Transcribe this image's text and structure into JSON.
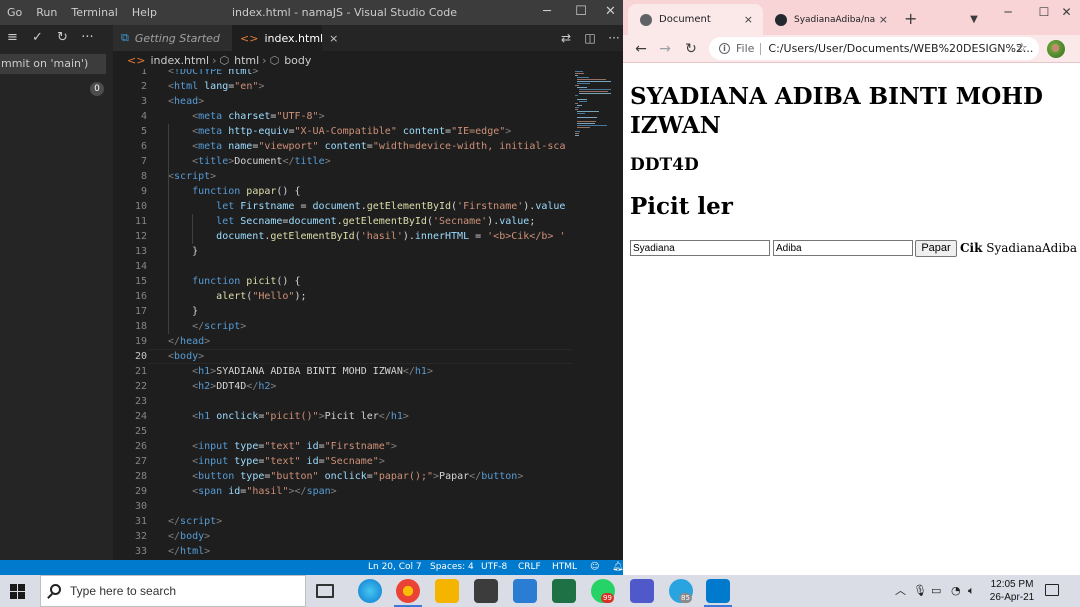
{
  "vscode": {
    "menu": [
      "Go",
      "Run",
      "Terminal",
      "Help"
    ],
    "window_title": "index.html - namaJS - Visual Studio Code",
    "commit_placeholder": "mmit on 'main')",
    "changes_badge": "0",
    "tabs": [
      {
        "label": "Getting Started"
      },
      {
        "label": "index.html",
        "close": "×"
      }
    ],
    "breadcrumb": [
      "index.html",
      "html",
      "body"
    ],
    "code_lines": [
      {
        "n": "1",
        "tokens": [
          [
            "t-br",
            "<"
          ],
          [
            "t-dt",
            "!DOCTYPE"
          ],
          [
            "t-txt",
            " "
          ],
          [
            "t-attr",
            "html"
          ],
          [
            "t-br",
            ">"
          ]
        ]
      },
      {
        "n": "2",
        "tokens": [
          [
            "t-br",
            "<"
          ],
          [
            "t-tag",
            "html"
          ],
          [
            "t-txt",
            " "
          ],
          [
            "t-attr",
            "lang"
          ],
          [
            "t-txt",
            "="
          ],
          [
            "t-str",
            "\"en\""
          ],
          [
            "t-br",
            ">"
          ]
        ]
      },
      {
        "n": "3",
        "tokens": [
          [
            "t-br",
            "<"
          ],
          [
            "t-tag",
            "head"
          ],
          [
            "t-br",
            ">"
          ]
        ]
      },
      {
        "n": "4",
        "tokens": [
          [
            "t-txt",
            "    "
          ],
          [
            "t-br",
            "<"
          ],
          [
            "t-tag",
            "meta"
          ],
          [
            "t-txt",
            " "
          ],
          [
            "t-attr",
            "charset"
          ],
          [
            "t-txt",
            "="
          ],
          [
            "t-str",
            "\"UTF-8\""
          ],
          [
            "t-br",
            ">"
          ]
        ]
      },
      {
        "n": "5",
        "tokens": [
          [
            "t-txt",
            "    "
          ],
          [
            "t-br",
            "<"
          ],
          [
            "t-tag",
            "meta"
          ],
          [
            "t-txt",
            " "
          ],
          [
            "t-attr",
            "http-equiv"
          ],
          [
            "t-txt",
            "="
          ],
          [
            "t-str",
            "\"X-UA-Compatible\""
          ],
          [
            "t-txt",
            " "
          ],
          [
            "t-attr",
            "content"
          ],
          [
            "t-txt",
            "="
          ],
          [
            "t-str",
            "\"IE=edge\""
          ],
          [
            "t-br",
            ">"
          ]
        ]
      },
      {
        "n": "6",
        "tokens": [
          [
            "t-txt",
            "    "
          ],
          [
            "t-br",
            "<"
          ],
          [
            "t-tag",
            "meta"
          ],
          [
            "t-txt",
            " "
          ],
          [
            "t-attr",
            "name"
          ],
          [
            "t-txt",
            "="
          ],
          [
            "t-str",
            "\"viewport\""
          ],
          [
            "t-txt",
            " "
          ],
          [
            "t-attr",
            "content"
          ],
          [
            "t-txt",
            "="
          ],
          [
            "t-str",
            "\"width=device-width, initial-sca"
          ]
        ]
      },
      {
        "n": "7",
        "tokens": [
          [
            "t-txt",
            "    "
          ],
          [
            "t-br",
            "<"
          ],
          [
            "t-tag",
            "title"
          ],
          [
            "t-br",
            ">"
          ],
          [
            "t-txt",
            "Document"
          ],
          [
            "t-br",
            "</"
          ],
          [
            "t-tag",
            "title"
          ],
          [
            "t-br",
            ">"
          ]
        ]
      },
      {
        "n": "8",
        "tokens": [
          [
            "t-br",
            "<"
          ],
          [
            "t-tag",
            "script"
          ],
          [
            "t-br",
            ">"
          ]
        ]
      },
      {
        "n": "9",
        "tokens": [
          [
            "t-txt",
            "    "
          ],
          [
            "t-kw",
            "function"
          ],
          [
            "t-txt",
            " "
          ],
          [
            "t-fn",
            "papar"
          ],
          [
            "t-txt",
            "() {"
          ]
        ]
      },
      {
        "n": "10",
        "tokens": [
          [
            "t-txt",
            "        "
          ],
          [
            "t-kw",
            "let"
          ],
          [
            "t-txt",
            " "
          ],
          [
            "t-var",
            "Firstname"
          ],
          [
            "t-txt",
            " = "
          ],
          [
            "t-var",
            "document"
          ],
          [
            "t-txt",
            "."
          ],
          [
            "t-fn",
            "getElementById"
          ],
          [
            "t-txt",
            "("
          ],
          [
            "t-str",
            "'Firstname'"
          ],
          [
            "t-txt",
            ")."
          ],
          [
            "t-var",
            "value"
          ]
        ]
      },
      {
        "n": "11",
        "tokens": [
          [
            "t-txt",
            "        "
          ],
          [
            "t-kw",
            "let"
          ],
          [
            "t-txt",
            " "
          ],
          [
            "t-var",
            "Secname"
          ],
          [
            "t-txt",
            "="
          ],
          [
            "t-var",
            "document"
          ],
          [
            "t-txt",
            "."
          ],
          [
            "t-fn",
            "getElementById"
          ],
          [
            "t-txt",
            "("
          ],
          [
            "t-str",
            "'Secname'"
          ],
          [
            "t-txt",
            ")."
          ],
          [
            "t-var",
            "value"
          ],
          [
            "t-txt",
            ";"
          ]
        ]
      },
      {
        "n": "12",
        "tokens": [
          [
            "t-txt",
            "        "
          ],
          [
            "t-var",
            "document"
          ],
          [
            "t-txt",
            "."
          ],
          [
            "t-fn",
            "getElementById"
          ],
          [
            "t-txt",
            "("
          ],
          [
            "t-str",
            "'hasil'"
          ],
          [
            "t-txt",
            ")."
          ],
          [
            "t-var",
            "innerHTML"
          ],
          [
            "t-txt",
            " = "
          ],
          [
            "t-str",
            "'<b>Cik</b> '"
          ]
        ]
      },
      {
        "n": "13",
        "tokens": [
          [
            "t-txt",
            "    }"
          ]
        ]
      },
      {
        "n": "14",
        "tokens": []
      },
      {
        "n": "15",
        "tokens": [
          [
            "t-txt",
            "    "
          ],
          [
            "t-kw",
            "function"
          ],
          [
            "t-txt",
            " "
          ],
          [
            "t-fn",
            "picit"
          ],
          [
            "t-txt",
            "() {"
          ]
        ]
      },
      {
        "n": "16",
        "tokens": [
          [
            "t-txt",
            "        "
          ],
          [
            "t-fn",
            "alert"
          ],
          [
            "t-txt",
            "("
          ],
          [
            "t-str",
            "\"Hello\""
          ],
          [
            "t-txt",
            ");"
          ]
        ]
      },
      {
        "n": "17",
        "tokens": [
          [
            "t-txt",
            "    }"
          ]
        ]
      },
      {
        "n": "18",
        "tokens": [
          [
            "t-txt",
            "    "
          ],
          [
            "t-br",
            "</"
          ],
          [
            "t-tag",
            "script"
          ],
          [
            "t-br",
            ">"
          ]
        ]
      },
      {
        "n": "19",
        "tokens": [
          [
            "t-br",
            "</"
          ],
          [
            "t-tag",
            "head"
          ],
          [
            "t-br",
            ">"
          ]
        ]
      },
      {
        "n": "20",
        "tokens": [
          [
            "t-br",
            "<"
          ],
          [
            "t-tag",
            "body"
          ],
          [
            "t-br",
            ">"
          ]
        ]
      },
      {
        "n": "21",
        "tokens": [
          [
            "t-txt",
            "    "
          ],
          [
            "t-br",
            "<"
          ],
          [
            "t-tag",
            "h1"
          ],
          [
            "t-br",
            ">"
          ],
          [
            "t-txt",
            "SYADIANA ADIBA BINTI MOHD IZWAN"
          ],
          [
            "t-br",
            "</"
          ],
          [
            "t-tag",
            "h1"
          ],
          [
            "t-br",
            ">"
          ]
        ]
      },
      {
        "n": "22",
        "tokens": [
          [
            "t-txt",
            "    "
          ],
          [
            "t-br",
            "<"
          ],
          [
            "t-tag",
            "h2"
          ],
          [
            "t-br",
            ">"
          ],
          [
            "t-txt",
            "DDT4D"
          ],
          [
            "t-br",
            "</"
          ],
          [
            "t-tag",
            "h2"
          ],
          [
            "t-br",
            ">"
          ]
        ]
      },
      {
        "n": "23",
        "tokens": []
      },
      {
        "n": "24",
        "tokens": [
          [
            "t-txt",
            "    "
          ],
          [
            "t-br",
            "<"
          ],
          [
            "t-tag",
            "h1"
          ],
          [
            "t-txt",
            " "
          ],
          [
            "t-attr",
            "onclick"
          ],
          [
            "t-txt",
            "="
          ],
          [
            "t-str",
            "\"picit()\""
          ],
          [
            "t-br",
            ">"
          ],
          [
            "t-txt",
            "Picit ler"
          ],
          [
            "t-br",
            "</"
          ],
          [
            "t-tag",
            "h1"
          ],
          [
            "t-br",
            ">"
          ]
        ]
      },
      {
        "n": "25",
        "tokens": []
      },
      {
        "n": "26",
        "tokens": [
          [
            "t-txt",
            "    "
          ],
          [
            "t-br",
            "<"
          ],
          [
            "t-tag",
            "input"
          ],
          [
            "t-txt",
            " "
          ],
          [
            "t-attr",
            "type"
          ],
          [
            "t-txt",
            "="
          ],
          [
            "t-str",
            "\"text\""
          ],
          [
            "t-txt",
            " "
          ],
          [
            "t-attr",
            "id"
          ],
          [
            "t-txt",
            "="
          ],
          [
            "t-str",
            "\"Firstname\""
          ],
          [
            "t-br",
            ">"
          ]
        ]
      },
      {
        "n": "27",
        "tokens": [
          [
            "t-txt",
            "    "
          ],
          [
            "t-br",
            "<"
          ],
          [
            "t-tag",
            "input"
          ],
          [
            "t-txt",
            " "
          ],
          [
            "t-attr",
            "type"
          ],
          [
            "t-txt",
            "="
          ],
          [
            "t-str",
            "\"text\""
          ],
          [
            "t-txt",
            " "
          ],
          [
            "t-attr",
            "id"
          ],
          [
            "t-txt",
            "="
          ],
          [
            "t-str",
            "\"Secname\""
          ],
          [
            "t-br",
            ">"
          ]
        ]
      },
      {
        "n": "28",
        "tokens": [
          [
            "t-txt",
            "    "
          ],
          [
            "t-br",
            "<"
          ],
          [
            "t-tag",
            "button"
          ],
          [
            "t-txt",
            " "
          ],
          [
            "t-attr",
            "type"
          ],
          [
            "t-txt",
            "="
          ],
          [
            "t-str",
            "\"button\""
          ],
          [
            "t-txt",
            " "
          ],
          [
            "t-attr",
            "onclick"
          ],
          [
            "t-txt",
            "="
          ],
          [
            "t-str",
            "\"papar();\""
          ],
          [
            "t-br",
            ">"
          ],
          [
            "t-txt",
            "Papar"
          ],
          [
            "t-br",
            "</"
          ],
          [
            "t-tag",
            "button"
          ],
          [
            "t-br",
            ">"
          ]
        ]
      },
      {
        "n": "29",
        "tokens": [
          [
            "t-txt",
            "    "
          ],
          [
            "t-br",
            "<"
          ],
          [
            "t-tag",
            "span"
          ],
          [
            "t-txt",
            " "
          ],
          [
            "t-attr",
            "id"
          ],
          [
            "t-txt",
            "="
          ],
          [
            "t-str",
            "\"hasil\""
          ],
          [
            "t-br",
            ">"
          ],
          [
            "t-br",
            "</"
          ],
          [
            "t-tag",
            "span"
          ],
          [
            "t-br",
            ">"
          ]
        ]
      },
      {
        "n": "30",
        "tokens": []
      },
      {
        "n": "31",
        "tokens": [
          [
            "t-br",
            "</"
          ],
          [
            "t-tag",
            "script"
          ],
          [
            "t-br",
            ">"
          ]
        ]
      },
      {
        "n": "32",
        "tokens": [
          [
            "t-br",
            "</"
          ],
          [
            "t-tag",
            "body"
          ],
          [
            "t-br",
            ">"
          ]
        ]
      },
      {
        "n": "33",
        "tokens": [
          [
            "t-br",
            "</"
          ],
          [
            "t-tag",
            "html"
          ],
          [
            "t-br",
            ">"
          ]
        ]
      }
    ],
    "active_line": "20",
    "status": {
      "position": "Ln 20, Col 7",
      "spaces": "Spaces: 4",
      "encoding": "UTF-8",
      "eol": "CRLF",
      "language": "HTML"
    }
  },
  "browser": {
    "tabs": [
      {
        "label": "Document",
        "close": "×"
      },
      {
        "label": "SyadianaAdiba/nam",
        "close": "×"
      }
    ],
    "new_tab": "+",
    "address_scheme": "File",
    "address_url": "C:/Users/User/Documents/WEB%20DESIGN%2...",
    "page": {
      "h1": "SYADIANA ADIBA BINTI MOHD IZWAN",
      "h2": "DDT4D",
      "h1_click": "Picit ler",
      "firstname_value": "Syadiana",
      "secname_value": "Adiba",
      "button_label": "Papar",
      "result_bold": "Cik",
      "result_text": "SyadianaAdiba"
    }
  },
  "taskbar": {
    "search_placeholder": "Type here to search",
    "whatsapp_badge": "99",
    "telegram_badge": "85",
    "time": "12:05 PM",
    "date": "26-Apr-21"
  },
  "colors": {
    "vscode_bg": "#1e1e1e",
    "statusbar": "#007acc",
    "browser_tabstrip": "#f8d4d6",
    "taskbar": "#dadce6"
  }
}
